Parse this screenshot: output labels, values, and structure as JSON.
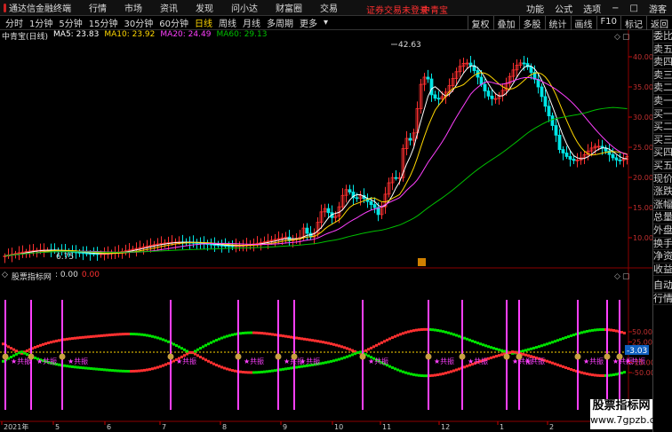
{
  "app": {
    "name": "通达信金融终端"
  },
  "menu": [
    "行情",
    "市场",
    "资讯",
    "发现",
    "问小达",
    "财富圈",
    "交易"
  ],
  "notice": {
    "text1": "证券交易未登录",
    "text2": "中青宝"
  },
  "menu_right": [
    "功能",
    "公式",
    "选项",
    "游客"
  ],
  "periods": [
    "分时",
    "1分钟",
    "5分钟",
    "15分钟",
    "30分钟",
    "60分钟",
    "日线",
    "周线",
    "月线",
    "多周期",
    "更多"
  ],
  "active_period": "日线",
  "tools": [
    "复权",
    "叠加",
    "多股",
    "统计",
    "画线",
    "F10",
    "标记",
    "返回"
  ],
  "info": {
    "stock": "中青宝(日线)",
    "ma5": "MA5: 23.83",
    "ma10": "MA10: 23.92",
    "ma20": "MA20: 24.49",
    "ma60": "MA60: 29.13"
  },
  "price_axis": [
    "40.00",
    "35.00",
    "30.00",
    "25.00",
    "20.00",
    "15.00",
    "10.00"
  ],
  "price_marks": {
    "high": "42.63",
    "low": "6.75"
  },
  "current_price_tag": "-3.03",
  "indicator": {
    "name": "股票指标网",
    "v1": ": 0.00",
    "v2": "0.00"
  },
  "ind_axis": [
    "50.00",
    "25.00",
    "-25.00",
    "-50.00"
  ],
  "date_axis": [
    "2021年",
    "5",
    "6",
    "7",
    "8",
    "9",
    "10",
    "11",
    "12",
    "1",
    "2"
  ],
  "signal_label": "共振",
  "right_panel": [
    "委比",
    "卖五",
    "卖四",
    "卖三",
    "卖二",
    "卖一",
    "买一",
    "买二",
    "买三",
    "买四",
    "买五",
    "现价",
    "涨跌",
    "涨幅",
    "总量",
    "外盘",
    "换手",
    "净资",
    "收益"
  ],
  "right_panel_bottom": [
    "自动",
    "行情"
  ],
  "watermark": {
    "line1": "股票指标网",
    "line2": "www.7gpzb.com"
  },
  "colors": {
    "up": "#ff3030",
    "down": "#00e5e5",
    "ma5": "#ffffff",
    "ma10": "#ffd700",
    "ma20": "#ff40ff",
    "ma60": "#00c000",
    "signal": "#ff40ff"
  }
}
